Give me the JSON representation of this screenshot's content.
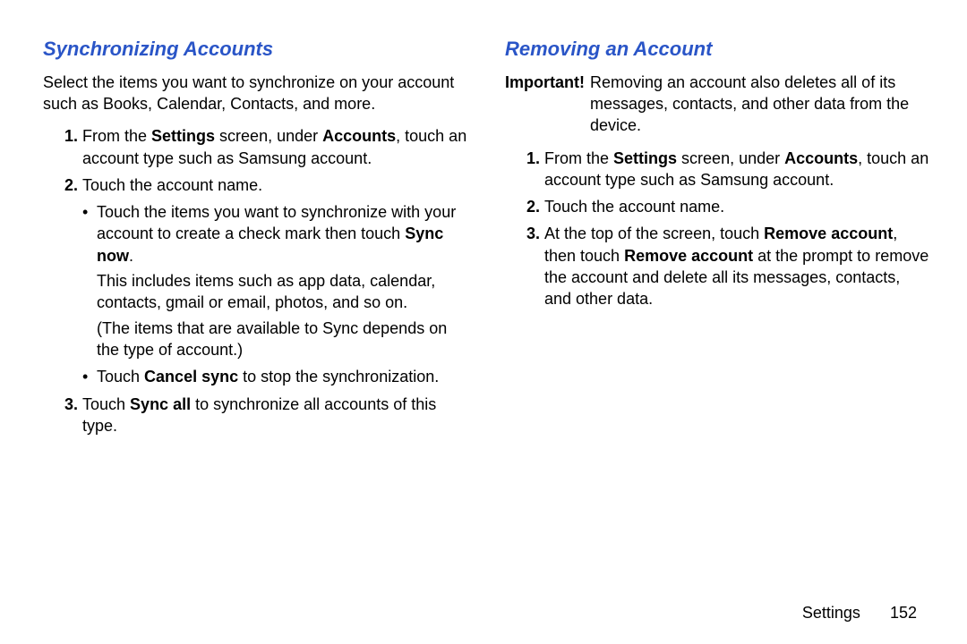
{
  "left": {
    "heading": "Synchronizing Accounts",
    "intro": "Select the items you want to synchronize on your account such as Books, Calendar, Contacts, and more.",
    "step1_a": "From the ",
    "step1_b1": "Settings",
    "step1_b": " screen, under ",
    "step1_b2": "Accounts",
    "step1_c": ", touch an account type such as Samsung account.",
    "step2": "Touch the account name.",
    "bullet1_a": "Touch the items you want to synchronize with your account to create a check mark then touch ",
    "bullet1_b": "Sync now",
    "bullet1_c": ".",
    "note1": "This includes items such as app data, calendar, contacts, gmail or email, photos, and so on.",
    "note2": "(The items that are available to Sync depends on the type of account.)",
    "bullet2_a": "Touch ",
    "bullet2_b": "Cancel sync",
    "bullet2_c": " to stop the synchronization.",
    "step3_a": "Touch ",
    "step3_b": "Sync all",
    "step3_c": " to synchronize all accounts of this type."
  },
  "right": {
    "heading": "Removing an Account",
    "impTag": "Important!",
    "impBody": "Removing an account also deletes all of its messages, contacts, and other data from the device.",
    "step1_a": "From the ",
    "step1_b1": "Settings",
    "step1_b": " screen, under ",
    "step1_b2": "Accounts",
    "step1_c": ", touch an account type such as Samsung account.",
    "step2": "Touch the account name.",
    "step3_a": "At the top of the screen, touch ",
    "step3_b": "Remove account",
    "step3_c": ", then touch ",
    "step3_d": "Remove account",
    "step3_e": " at the prompt to remove the account and delete all its messages, contacts, and other data."
  },
  "footer": {
    "section": "Settings",
    "page": "152"
  }
}
